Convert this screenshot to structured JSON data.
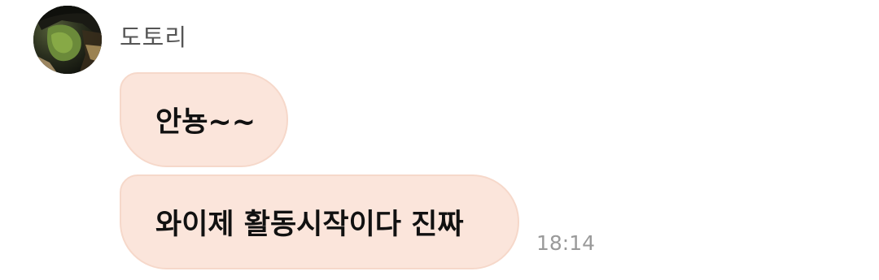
{
  "message_group": {
    "sender_name": "도토리",
    "avatar_icon": "profile-photo-icon",
    "messages": [
      {
        "text": "안뇽~~"
      },
      {
        "text": "와이제 활동시작이다 진짜"
      }
    ],
    "timestamp": "18:14"
  },
  "colors": {
    "bubble_background": "#fbe5db",
    "bubble_border": "#f6d8ca",
    "sender_text": "#555555",
    "timestamp_text": "#9a9a9a"
  }
}
